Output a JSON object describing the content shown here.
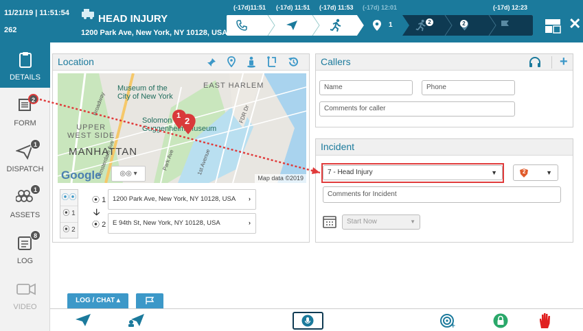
{
  "header": {
    "date": "11/21/19",
    "time": "11:51:54",
    "incident_number": "262",
    "incident_type": "HEAD INJURY",
    "address": "1200 Park Ave, New York, NY 10128, USA",
    "step_times": [
      "(-17d)11:51",
      "(-17d) 11:51",
      "(-17d) 11:53",
      "(-17d) 12:01",
      "(-17d) 12:23"
    ],
    "step_badges": [
      "1",
      "2",
      "2"
    ]
  },
  "sidebar": {
    "items": [
      {
        "label": "DETAILS",
        "badge": ""
      },
      {
        "label": "FORM",
        "badge": "2"
      },
      {
        "label": "DISPATCH",
        "badge": "1"
      },
      {
        "label": "ASSETS",
        "badge": "1"
      },
      {
        "label": "LOG",
        "badge": "8"
      },
      {
        "label": "VIDEO",
        "badge": ""
      }
    ]
  },
  "location": {
    "title": "Location",
    "map_labels": {
      "east_harlem": "EAST HARLEM",
      "museum": "Museum of the",
      "museum2": "City of New York",
      "upper_west": "UPPER",
      "upper_west2": "WEST SIDE",
      "manhattan": "MANHATTAN",
      "guggenheim": "Solomon R.",
      "guggenheim2": "Guggenheim Museum",
      "fdr": "FDR Dr",
      "broadway": "Broadway",
      "amsterdam": "Amsterdam Ave",
      "park_ave": "Park Ave",
      "first_ave": "1st Avenue",
      "google": "Google",
      "map_data": "Map data ©2019",
      "marker_1": "1",
      "marker_2": "2"
    },
    "address_1_index": "1",
    "address_1": "1200 Park Ave, New York, NY 10128, USA",
    "address_2_index": "2",
    "address_2": "E 94th St, New York, NY 10128, USA",
    "list_numbers": [
      "1",
      "2"
    ]
  },
  "callers": {
    "title": "Callers",
    "name_placeholder": "Name",
    "phone_placeholder": "Phone",
    "comments_placeholder": "Comments for caller"
  },
  "incident": {
    "title": "Incident",
    "type_value": "7 - Head Injury",
    "priority_badge": "2",
    "comments_placeholder": "Comments for Incident",
    "start_value": "Start Now"
  },
  "bottom": {
    "log_chat_label": "LOG / CHAT"
  },
  "colors": {
    "brand": "#1b7a9c",
    "accent_red": "#e03a3a",
    "lock_green": "#2aa86a"
  }
}
